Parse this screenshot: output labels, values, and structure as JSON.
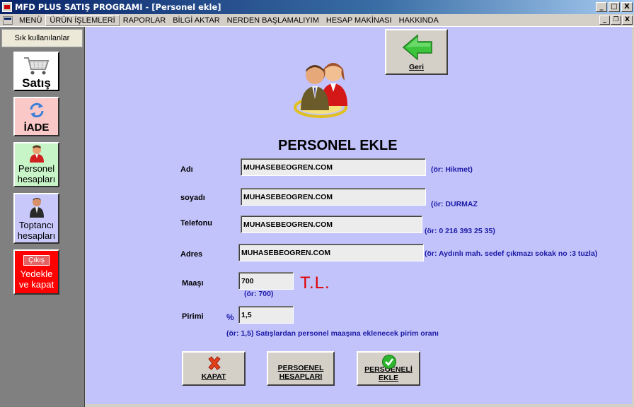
{
  "window": {
    "title": "MFD PLUS  SATIŞ PROGRAMI - [Personel ekle]",
    "minimize": "_",
    "maximize": "□",
    "close": "X"
  },
  "menu": {
    "items": [
      "MENÜ",
      "ÜRÜN İŞLEMLERİ",
      "RAPORLAR",
      "BİLGİ AKTAR",
      "NERDEN BAŞLAMALIYIM",
      "HESAP MAKİNASI",
      "HAKKINDA"
    ],
    "mdi_minimize": "_",
    "mdi_restore": "❐",
    "mdi_close": "X"
  },
  "sidebar": {
    "header": "Sık kullanılanlar",
    "buttons": [
      {
        "label": "Satış",
        "icon": "shopping-cart-icon",
        "bg": "#ffffff"
      },
      {
        "label": "İADE",
        "icon": "refresh-icon",
        "bg": "#fbc8c8"
      },
      {
        "label": "Personel hesapları",
        "icon": "person-icon",
        "bg": "#c8f5c8"
      },
      {
        "label": "Toptancı hesapları",
        "icon": "businessman-icon",
        "bg": "#c8c8fb"
      },
      {
        "label": "Yedekle ve kapat",
        "badge": "Çıkış",
        "icon": "exit-icon",
        "bg": "#ff0000"
      }
    ]
  },
  "main": {
    "back_button": "Geri",
    "heading": "PERSONEL EKLE",
    "fields": {
      "ad": {
        "label": "Adı",
        "value": "MUHASEBEOGREN.COM",
        "hint": "(ör:  Hikmet)"
      },
      "soyad": {
        "label": "soyadı",
        "value": "MUHASEBEOGREN.COM",
        "hint": "(ör:  DURMAZ"
      },
      "telefon": {
        "label": "Telefonu",
        "value": "MUHASEBEOGREN.COM",
        "hint": "(ör:  0 216 393 25 35)"
      },
      "adres": {
        "label": "Adres",
        "value": "MUHASEBEOGREN.COM",
        "hint": "(ör:  Aydınlı mah. sedef çıkmazı sokak no :3 tuzla)"
      },
      "maas": {
        "label": "Maaşı",
        "value": "700",
        "hint": "(ör: 700)",
        "currency": "T.L."
      },
      "prim": {
        "label": "Pirimi",
        "percent": "%",
        "value": "1,5",
        "hint": "(ör:  1,5) Satışlardan personel maaşına eklenecek pirim oranı"
      }
    },
    "buttons": {
      "close": "KAPAT",
      "accounts": "PERSOENEL HESAPLARI",
      "add": "PERSOENELİ EKLE"
    }
  },
  "colors": {
    "main_bg": "#c3c3fb",
    "hint": "#1a1aa6",
    "currency": "#e00000",
    "titlebar": "#0a246a"
  }
}
